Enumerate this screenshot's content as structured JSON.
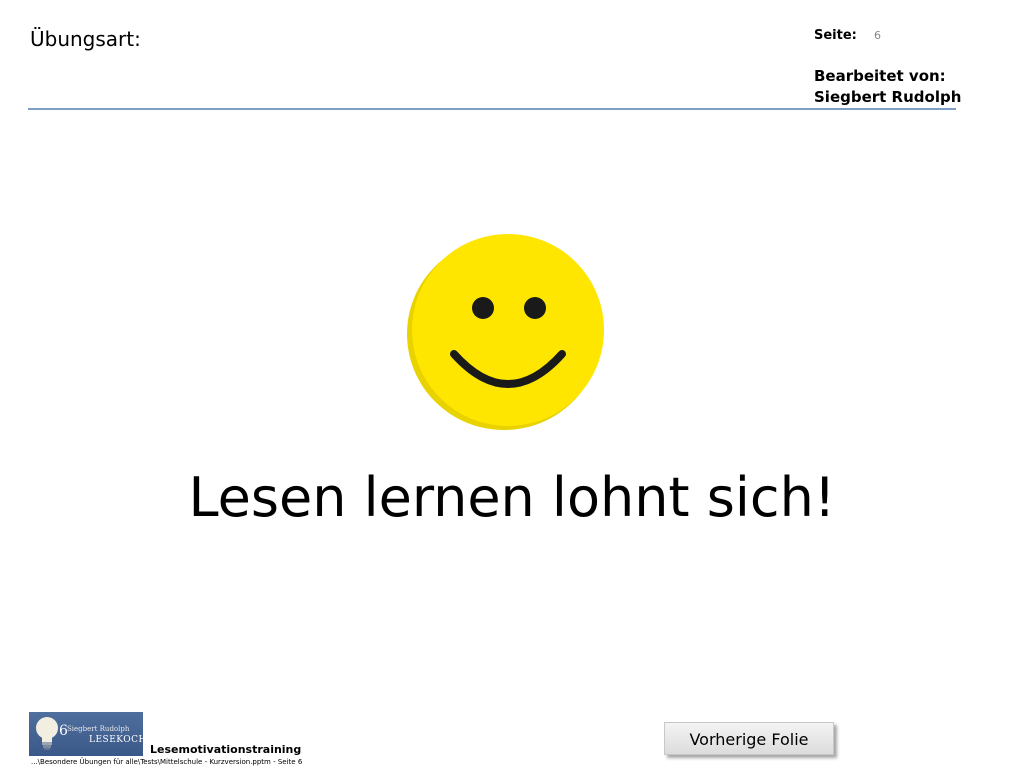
{
  "header": {
    "exercise_label": "Übungsart:",
    "page_label": "Seite:",
    "page_number": "6",
    "edited_by_label": "Bearbeitet von:",
    "author": "Siegbert Rudolph"
  },
  "main": {
    "smiley_icon": "smiley-face-icon",
    "smiley_color": "#ffe600",
    "headline": "Lesen lernen lohnt sich!"
  },
  "footer": {
    "logo": {
      "name": "Siegbert Rudolph",
      "word": "LESEKOCH",
      "digit": "6"
    },
    "course_title": "Lesemotivationstraining",
    "file_path": "...\\Besondere Übungen für alle\\Tests\\Mittelschule - Kurzversion.pptm - Seite 6",
    "prev_button_label": "Vorherige  Folie"
  },
  "colors": {
    "header_rule": "#7f9ec4",
    "logo_background": "#4f6f9f"
  }
}
